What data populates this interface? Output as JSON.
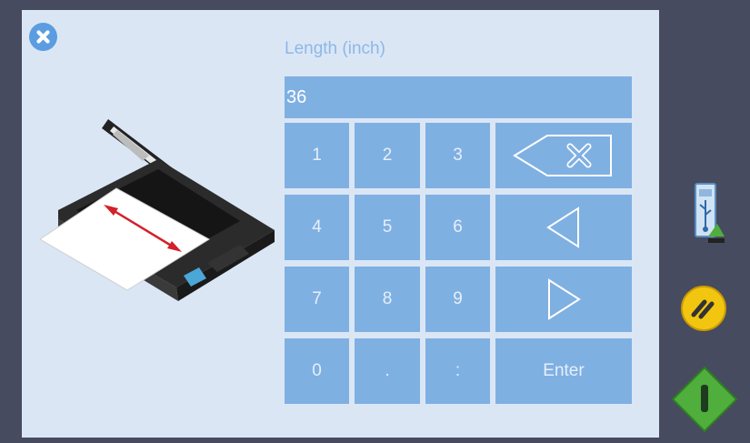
{
  "dialog": {
    "field_label": "Length (inch)",
    "value": "36",
    "close_icon": "close-icon",
    "illustration": "scanner-length-illustration"
  },
  "keypad": {
    "k1": "1",
    "k2": "2",
    "k3": "3",
    "k4": "4",
    "k5": "5",
    "k6": "6",
    "k7": "7",
    "k8": "8",
    "k9": "9",
    "k0": "0",
    "kdot": ".",
    "kcolon": ":",
    "enter": "Enter",
    "backspace_icon": "backspace-icon",
    "left_icon": "arrow-left-icon",
    "right_icon": "arrow-right-icon"
  },
  "sidebar": {
    "usb_icon": "usb-icon",
    "stop_icon": "stop-icon",
    "start_icon": "start-icon"
  },
  "colors": {
    "background": "#464b60",
    "panel": "#dbe6f5",
    "key": "#7fb0e2",
    "key_text": "#e6eff9",
    "label": "#8cb8e8",
    "close": "#5b9de0",
    "stop": "#f2c511",
    "start": "#4fae3c"
  }
}
